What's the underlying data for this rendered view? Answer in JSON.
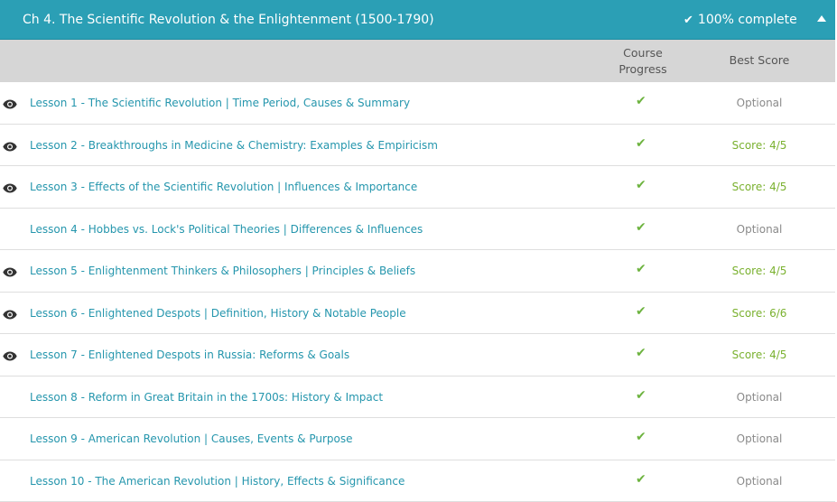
{
  "chapter": {
    "title": "Ch 4. The Scientific Revolution & the Enlightenment (1500-1790)",
    "complete_label": "100% complete",
    "check_glyph": "✔",
    "collapse_icon": "caret-up-icon"
  },
  "columns": {
    "progress": "Course Progress",
    "score": "Best Score"
  },
  "colors": {
    "header_bg": "#2b9fb5",
    "link": "#2596ad",
    "check": "#6db33f",
    "score": "#7ab12f",
    "optional": "#8a8a8a"
  },
  "lessons": [
    {
      "title": "Lesson 1 - The Scientific Revolution | Time Period, Causes & Summary",
      "check": "✔",
      "score": "Optional",
      "viewed": true
    },
    {
      "title": "Lesson 2 - Breakthroughs in Medicine & Chemistry: Examples & Empiricism",
      "check": "✔",
      "score": "Score: 4/5",
      "viewed": true
    },
    {
      "title": "Lesson 3 - Effects of the Scientific Revolution | Influences & Importance",
      "check": "✔",
      "score": "Score: 4/5",
      "viewed": true
    },
    {
      "title": "Lesson 4 - Hobbes vs. Lock's Political Theories | Differences & Influences",
      "check": "✔",
      "score": "Optional",
      "viewed": false
    },
    {
      "title": "Lesson 5 - Enlightenment Thinkers & Philosophers | Principles & Beliefs",
      "check": "✔",
      "score": "Score: 4/5",
      "viewed": true
    },
    {
      "title": "Lesson 6 - Enlightened Despots | Definition, History & Notable People",
      "check": "✔",
      "score": "Score: 6/6",
      "viewed": true
    },
    {
      "title": "Lesson 7 - Enlightened Despots in Russia: Reforms & Goals",
      "check": "✔",
      "score": "Score: 4/5",
      "viewed": true
    },
    {
      "title": "Lesson 8 - Reform in Great Britain in the 1700s: History & Impact",
      "check": "✔",
      "score": "Optional",
      "viewed": false
    },
    {
      "title": "Lesson 9 - American Revolution | Causes, Events & Purpose",
      "check": "✔",
      "score": "Optional",
      "viewed": false
    },
    {
      "title": "Lesson 10 - The American Revolution | History, Effects & Significance",
      "check": "✔",
      "score": "Optional",
      "viewed": false
    }
  ]
}
